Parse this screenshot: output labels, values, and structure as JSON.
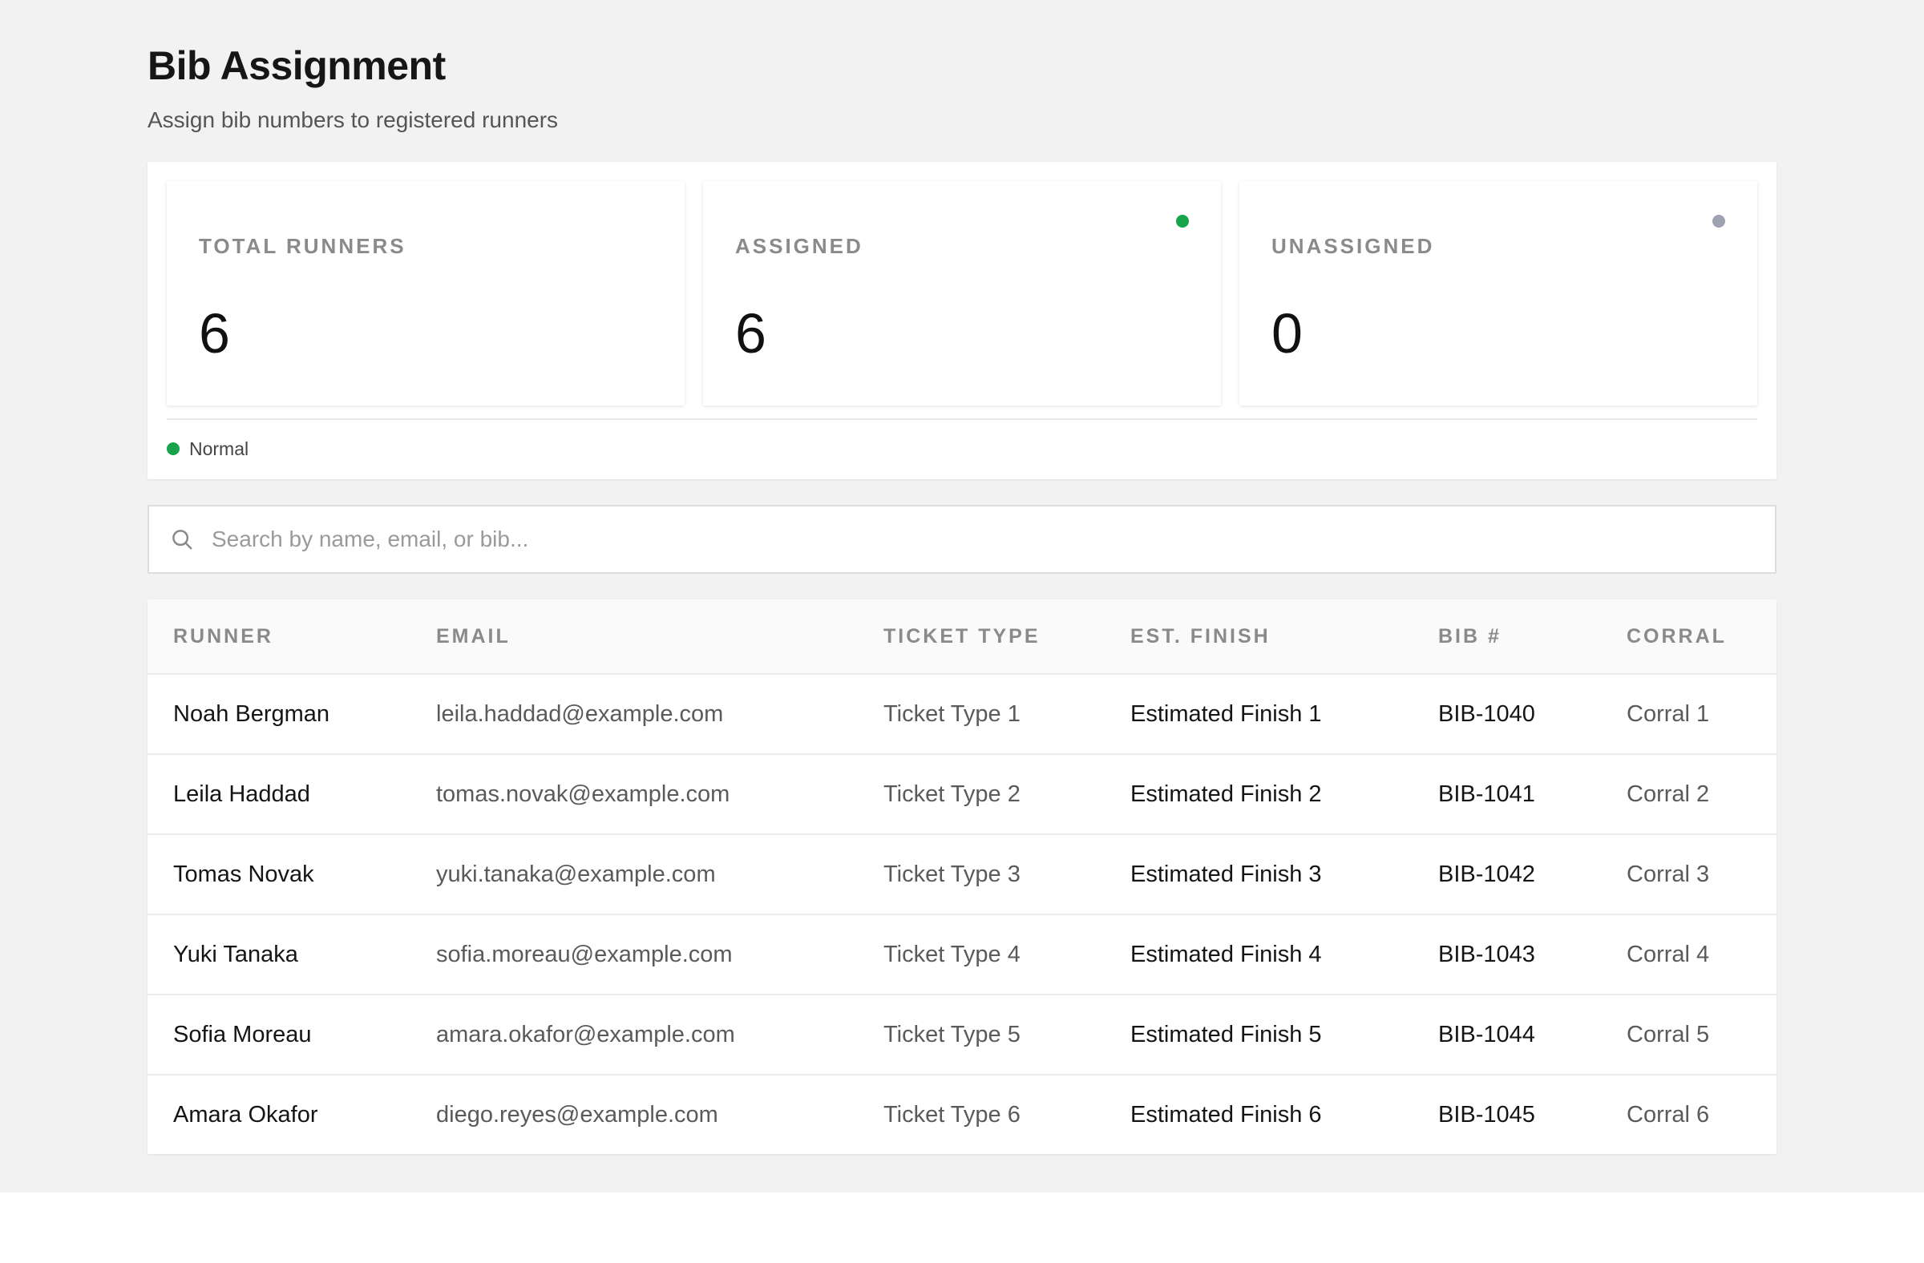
{
  "page": {
    "title": "Bib Assignment",
    "subtitle": "Assign bib numbers to registered runners"
  },
  "stats": [
    {
      "label": "TOTAL RUNNERS",
      "value": "6",
      "dot_color": null
    },
    {
      "label": "ASSIGNED",
      "value": "6",
      "dot_color": "#16a34a"
    },
    {
      "label": "UNASSIGNED",
      "value": "0",
      "dot_color": "#9ca3af"
    }
  ],
  "status": {
    "label": "Normal",
    "color": "#16a34a",
    "icon": "status-dot-icon"
  },
  "search": {
    "placeholder": "Search by name, email, or bib...",
    "value": "",
    "icon": "search-icon"
  },
  "table": {
    "columns": [
      "RUNNER",
      "EMAIL",
      "TICKET TYPE",
      "EST. FINISH",
      "BIB #",
      "CORRAL"
    ],
    "rows": [
      {
        "runner": "Noah Bergman",
        "email": "leila.haddad@example.com",
        "ticket": "Ticket Type 1",
        "finish": "Estimated Finish 1",
        "bib": "BIB-1040",
        "corral": "Corral 1"
      },
      {
        "runner": "Leila Haddad",
        "email": "tomas.novak@example.com",
        "ticket": "Ticket Type 2",
        "finish": "Estimated Finish 2",
        "bib": "BIB-1041",
        "corral": "Corral 2"
      },
      {
        "runner": "Tomas Novak",
        "email": "yuki.tanaka@example.com",
        "ticket": "Ticket Type 3",
        "finish": "Estimated Finish 3",
        "bib": "BIB-1042",
        "corral": "Corral 3"
      },
      {
        "runner": "Yuki Tanaka",
        "email": "sofia.moreau@example.com",
        "ticket": "Ticket Type 4",
        "finish": "Estimated Finish 4",
        "bib": "BIB-1043",
        "corral": "Corral 4"
      },
      {
        "runner": "Sofia Moreau",
        "email": "amara.okafor@example.com",
        "ticket": "Ticket Type 5",
        "finish": "Estimated Finish 5",
        "bib": "BIB-1044",
        "corral": "Corral 5"
      },
      {
        "runner": "Amara Okafor",
        "email": "diego.reyes@example.com",
        "ticket": "Ticket Type 6",
        "finish": "Estimated Finish 6",
        "bib": "BIB-1045",
        "corral": "Corral 6"
      }
    ]
  },
  "colors": {
    "background": "#f2f2f2",
    "surface": "#ffffff",
    "success": "#16a34a",
    "neutral_dot": "#9ca3af",
    "text_muted": "#8a8a8a"
  }
}
